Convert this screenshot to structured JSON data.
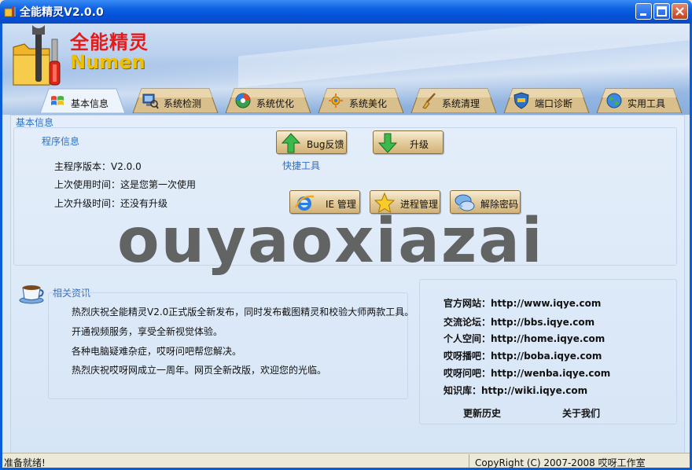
{
  "window": {
    "title": "全能精灵V2.0.0",
    "icon": "folder-tools-icon"
  },
  "header": {
    "logo_cn": "全能精灵",
    "logo_en": "Numen"
  },
  "tabs": [
    {
      "label": "基本信息",
      "icon": "windows-flag-icon",
      "active": true
    },
    {
      "label": "系统检测",
      "icon": "pc-check-icon"
    },
    {
      "label": "系统优化",
      "icon": "gauge-icon"
    },
    {
      "label": "系统美化",
      "icon": "paint-icon"
    },
    {
      "label": "系统清理",
      "icon": "broom-icon"
    },
    {
      "label": "端口诊断",
      "icon": "shield-icon"
    },
    {
      "label": "实用工具",
      "icon": "globe-icon"
    }
  ],
  "basic": {
    "section_title": "基本信息",
    "program_info_title": "程序信息",
    "lines": [
      "主程序版本：V2.0.0",
      "上次使用时间：这是您第一次使用",
      "上次升级时间：还没有升级"
    ]
  },
  "top_buttons": {
    "bug": "Bug反馈",
    "upgrade": "升级"
  },
  "quick_tools": {
    "title": "快捷工具",
    "ie": "IE 管理",
    "process": "进程管理",
    "unlock": "解除密码"
  },
  "watermark": "ouyaoxiazai",
  "news": {
    "title": "相关资讯",
    "items": [
      "热烈庆祝全能精灵V2.0正式版全新发布，同时发布截图精灵和校验大师两款工具。",
      "开通视频服务，享受全新视觉体验。",
      "各种电脑疑难杂症，哎呀问吧帮您解决。",
      "热烈庆祝哎呀网成立一周年。网页全新改版，欢迎您的光临。"
    ]
  },
  "links": [
    {
      "label": "官方网站：",
      "url": "http://www.iqye.com"
    },
    {
      "label": "交流论坛：",
      "url": "http://bbs.iqye.com"
    },
    {
      "label": "个人空间：",
      "url": "http://home.iqye.com"
    },
    {
      "label": "哎呀播吧：",
      "url": "http://boba.iqye.com"
    },
    {
      "label": "哎呀问吧：",
      "url": "http://wenba.iqye.com"
    },
    {
      "label": "知识库：",
      "url": "http://wiki.iqye.com"
    }
  ],
  "footer_links": {
    "history": "更新历史",
    "about": "关于我们"
  },
  "status": {
    "left": "准备就绪!",
    "right": "CopyRight (C) 2007-2008 哎呀工作室"
  }
}
